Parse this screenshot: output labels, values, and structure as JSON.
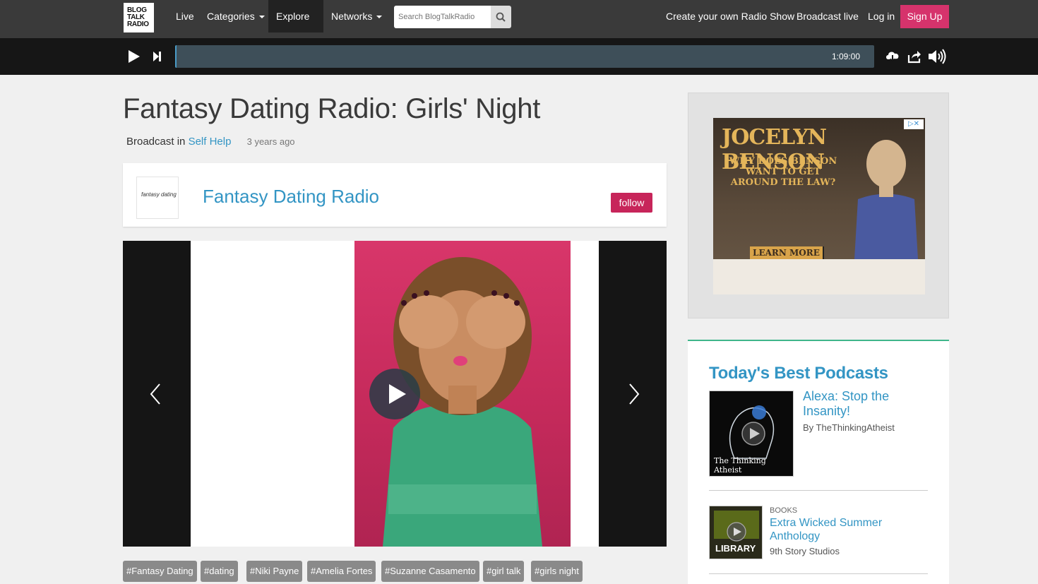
{
  "nav": {
    "logo_lines": [
      "BLOG",
      "TALK",
      "RADIO"
    ],
    "live": "Live",
    "categories": "Categories",
    "explore": "Explore",
    "networks": "Networks",
    "search_placeholder": "Search BlogTalkRadio",
    "create_show": "Create your own Radio Show",
    "broadcast_live": "Broadcast live",
    "login": "Log in",
    "signup": "Sign Up"
  },
  "player": {
    "duration": "1:09:00"
  },
  "episode": {
    "title": "Fantasy Dating Radio: Girls' Night",
    "broadcast_prefix": "Broadcast in",
    "category": "Self Help",
    "ago": "3 years ago"
  },
  "show": {
    "thumb_text": "fantasy dating",
    "name": "Fantasy Dating Radio",
    "follow_label": "follow"
  },
  "tags": [
    "#Fantasy Dating",
    "#dating",
    "#Niki Payne",
    "#Amelia Fortes",
    "#Suzanne Casamento",
    "#girl talk",
    "#girls night"
  ],
  "ad": {
    "headline": "JOCELYN BENSON",
    "sub": "WHY DOES BENSON WANT TO GET AROUND THE LAW?",
    "cta": "LEARN MORE",
    "close": "▷✕"
  },
  "podcasts": {
    "heading": "Today's Best Podcasts",
    "items": [
      {
        "title": "Alexa: Stop the Insanity!",
        "by": "By TheThinkingAtheist",
        "thumb_text": "The Thinking Atheist",
        "category": ""
      },
      {
        "title": "Extra Wicked Summer Anthology",
        "by": "9th Story Studios",
        "thumb_text": "LIBRARY",
        "category": "BOOKS"
      }
    ]
  },
  "colors": {
    "accent": "#3395c4",
    "signup": "#d6336c",
    "follow": "#c7255a",
    "pods_border": "#3fb68b"
  }
}
